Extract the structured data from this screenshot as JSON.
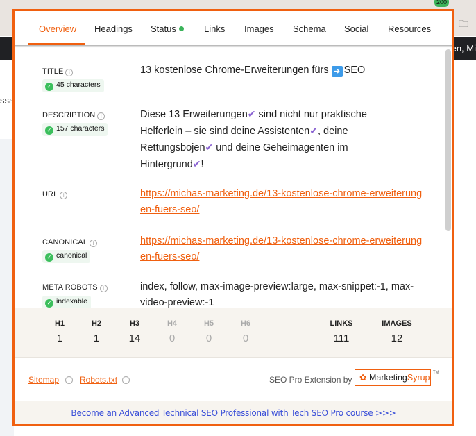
{
  "browser": {
    "badge": "200",
    "bg_text_right": "en, Mi",
    "bg_text_left": "ssa"
  },
  "tabs": [
    {
      "label": "Overview",
      "active": true
    },
    {
      "label": "Headings"
    },
    {
      "label": "Status",
      "status_dot": "#3bb35a"
    },
    {
      "label": "Links"
    },
    {
      "label": "Images"
    },
    {
      "label": "Schema"
    },
    {
      "label": "Social"
    },
    {
      "label": "Resources"
    }
  ],
  "overview": {
    "title": {
      "label": "TITLE",
      "badge": "45 characters",
      "value": "13 kostenlose Chrome-Erweiterungen fürs",
      "value_end": "SEO",
      "icon": "right-arrow-emoji"
    },
    "description": {
      "label": "DESCRIPTION",
      "badge": "157 characters",
      "segments": [
        "Diese 13 Erweiterungen",
        "sind nicht nur praktische Helferlein – sie sind deine Assistenten",
        ", deine Rettungsbojen",
        "und deine Geheimagenten im Hintergrund",
        "!"
      ],
      "check": "✔"
    },
    "url": {
      "label": "URL",
      "value": "https://michas-marketing.de/13-kostenlose-chrome-erweiterungen-fuers-seo/"
    },
    "canonical": {
      "label": "CANONICAL",
      "badge": "canonical",
      "value": "https://michas-marketing.de/13-kostenlose-chrome-erweiterungen-fuers-seo/"
    },
    "meta_robots": {
      "label": "META ROBOTS",
      "badge": "indexable",
      "value": "index, follow, max-image-preview:large, max-snippet:-1, max-video-preview:-1"
    }
  },
  "stats": {
    "headings": [
      {
        "h": "H1",
        "n": "1"
      },
      {
        "h": "H2",
        "n": "1"
      },
      {
        "h": "H3",
        "n": "14"
      },
      {
        "h": "H4",
        "n": "0"
      },
      {
        "h": "H5",
        "n": "0"
      },
      {
        "h": "H6",
        "n": "0"
      }
    ],
    "links": {
      "h": "LINKS",
      "n": "111"
    },
    "images": {
      "h": "IMAGES",
      "n": "12"
    }
  },
  "footer": {
    "sitemap": "Sitemap",
    "robots": "Robots.txt",
    "by": "SEO Pro Extension by",
    "logo_a": "Marketing",
    "logo_b": "Syrup",
    "tm": "TM"
  },
  "banner": "Become an Advanced Technical SEO Professional with Tech SEO Pro course >>>",
  "colors": {
    "accent": "#f06010",
    "ok": "#3bbf5c",
    "link_blue": "#3a4fd8",
    "check": "#8a63d2"
  }
}
